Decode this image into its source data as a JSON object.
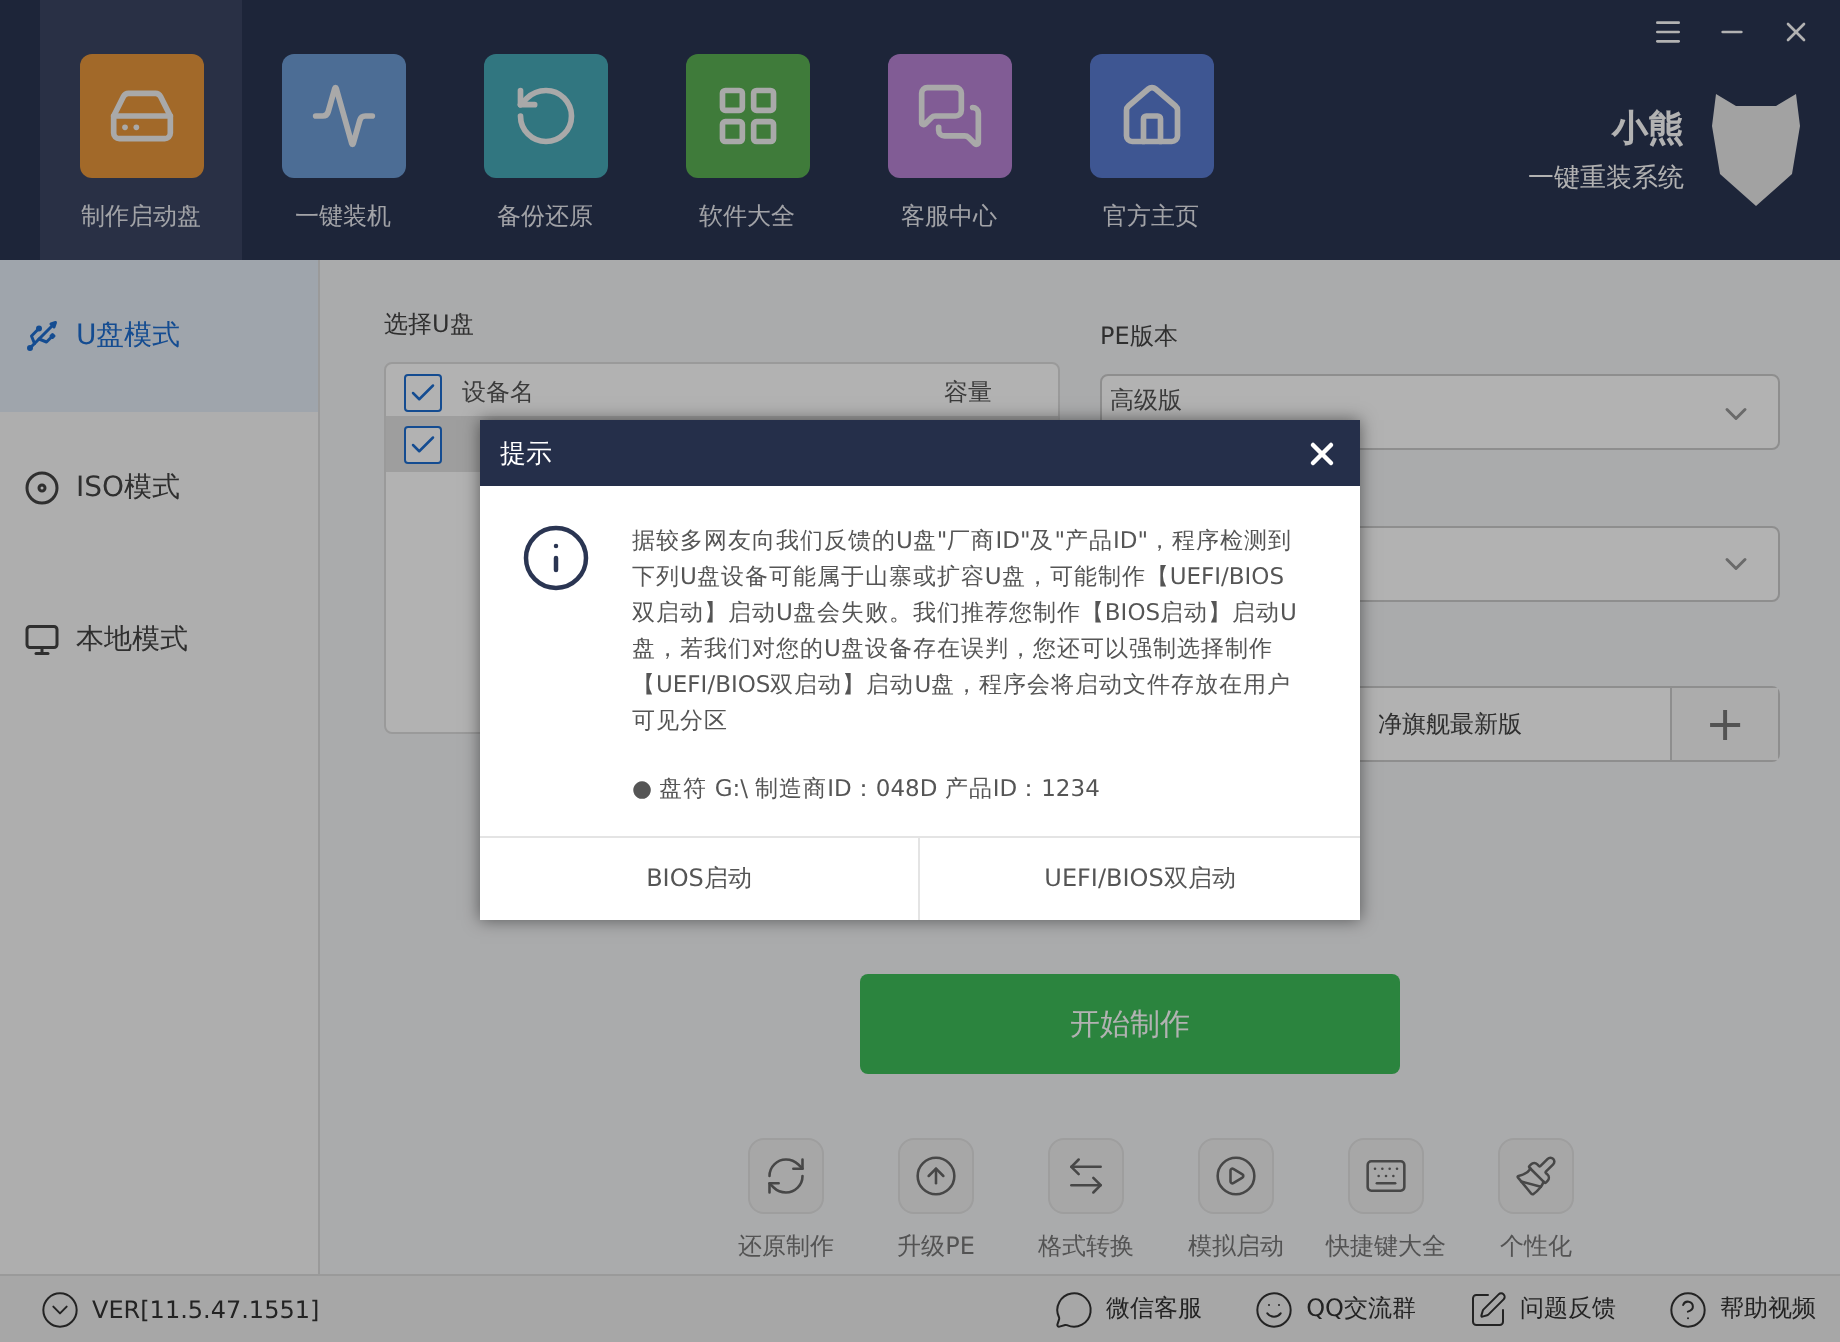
{
  "header": {
    "nav": [
      {
        "label": "制作启动盘",
        "selected": true
      },
      {
        "label": "一键装机",
        "selected": false
      },
      {
        "label": "备份还原",
        "selected": false
      },
      {
        "label": "软件大全",
        "selected": false
      },
      {
        "label": "客服中心",
        "selected": false
      },
      {
        "label": "官方主页",
        "selected": false
      }
    ],
    "logo": {
      "name": "小熊",
      "slogan": "一键重装系统"
    }
  },
  "sidebar": {
    "modes": [
      {
        "label": "U盘模式",
        "selected": true
      },
      {
        "label": "ISO模式",
        "selected": false
      },
      {
        "label": "本地模式",
        "selected": false
      }
    ]
  },
  "usb_select": {
    "label": "选择U盘",
    "header_checked": true,
    "columns": [
      "设备名",
      "容量"
    ],
    "rows": [
      {
        "checked": true,
        "selected": true
      }
    ]
  },
  "pe": {
    "label": "PE版本",
    "version": "高级版",
    "system": "净旗舰最新版",
    "add_button": "+"
  },
  "start_button": "开始制作",
  "tools": [
    {
      "label": "还原制作"
    },
    {
      "label": "升级PE"
    },
    {
      "label": "格式转换"
    },
    {
      "label": "模拟启动"
    },
    {
      "label": "快捷键大全"
    },
    {
      "label": "个性化"
    }
  ],
  "status_bar": {
    "version": "VER[11.5.47.1551]",
    "links": [
      {
        "label": "微信客服"
      },
      {
        "label": "QQ交流群"
      },
      {
        "label": "问题反馈"
      },
      {
        "label": "帮助视频"
      }
    ]
  },
  "dialog": {
    "title": "提示",
    "message": "据较多网友向我们反馈的U盘\"厂商ID\"及\"产品ID\"，程序检测到下列U盘设备可能属于山寨或扩容U盘，可能制作【UEFI/BIOS双启动】启动U盘会失败。我们推荐您制作【BIOS启动】启动U盘，若我们对您的U盘设备存在误判，您还可以强制选择制作【UEFI/BIOS双启动】启动U盘，程序会将启动文件存放在用户可见分区",
    "device_info": "● 盘符 G:\\ 制造商ID：048D 产品ID：1234",
    "buttons": [
      "BIOS启动",
      "UEFI/BIOS双启动"
    ]
  }
}
